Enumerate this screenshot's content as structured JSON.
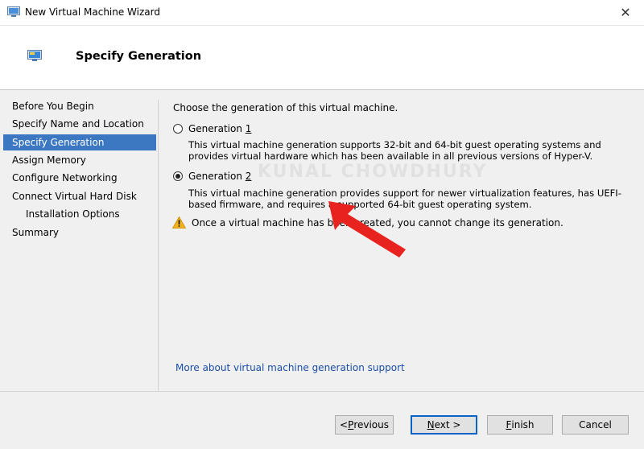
{
  "window": {
    "title": "New Virtual Machine Wizard",
    "close_glyph": "✕"
  },
  "header": {
    "title": "Specify Generation"
  },
  "sidebar": {
    "items": [
      {
        "label": "Before You Begin"
      },
      {
        "label": "Specify Name and Location"
      },
      {
        "label": "Specify Generation",
        "selected": true
      },
      {
        "label": "Assign Memory"
      },
      {
        "label": "Configure Networking"
      },
      {
        "label": "Connect Virtual Hard Disk"
      },
      {
        "label": "Installation Options",
        "sub": true
      },
      {
        "label": "Summary"
      }
    ]
  },
  "main": {
    "intro": "Choose the generation of this virtual machine.",
    "gen1": {
      "label": "Generation ",
      "accel": "1",
      "checked": false,
      "description": "This virtual machine generation supports 32-bit and 64-bit guest operating systems and provides virtual hardware which has been available in all previous versions of Hyper-V."
    },
    "gen2": {
      "label": "Generation ",
      "accel": "2",
      "checked": true,
      "description": "This virtual machine generation provides support for newer virtualization features, has UEFI-based firmware, and requires a supported 64-bit guest operating system."
    },
    "warning": "Once a virtual machine has been created, you cannot change its generation.",
    "more_link": "More about virtual machine generation support",
    "watermark": "KUNAL CHOWDHURY"
  },
  "buttons": {
    "previous": {
      "accel": "P",
      "rest": "revious",
      "prefix": "< "
    },
    "next": {
      "accel": "N",
      "rest": "ext >"
    },
    "finish": {
      "accel": "F",
      "rest": "inish"
    },
    "cancel": {
      "label": "Cancel"
    }
  },
  "colors": {
    "selection": "#3c77c2",
    "link": "#1a4ea8",
    "arrow": "#e8231f",
    "warning": "#f2b21b"
  },
  "icons": [
    "app-icon",
    "vm-header-icon",
    "close-icon",
    "warning-icon",
    "arrow-annotation"
  ]
}
